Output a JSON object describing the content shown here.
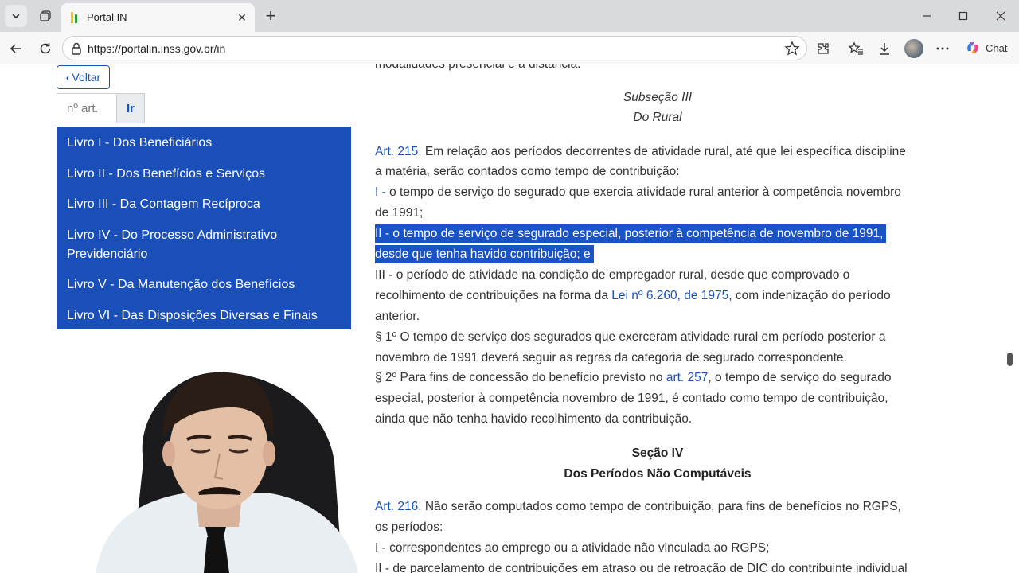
{
  "browser": {
    "tab_title": "Portal IN",
    "url": "https://portalin.inss.gov.br/in",
    "copilot_label": "Chat",
    "icons": [
      "tab-actions-icon",
      "workspaces-icon",
      "new-tab-icon",
      "minimize-icon",
      "maximize-icon",
      "close-window-icon",
      "back-icon",
      "refresh-icon",
      "lock-icon",
      "favorite-star-icon",
      "extensions-icon",
      "favorites-icon",
      "downloads-icon",
      "profile-avatar",
      "more-icon",
      "copilot-icon"
    ]
  },
  "sidebar": {
    "back_label": "Voltar",
    "article_placeholder": "nº art.",
    "go_label": "Ir",
    "livros": [
      {
        "line1": "Livro I - Dos Beneficiários"
      },
      {
        "line1": "Livro II - Dos Benefícios e Serviços"
      },
      {
        "line1": "Livro III - Da Contagem Recíproca"
      },
      {
        "line1": "Livro IV - Do Processo Administrativo",
        "line2": "Previdenciário"
      },
      {
        "line1": "Livro V - Da Manutenção dos Benefícios"
      },
      {
        "line1": "Livro VI - Das Disposições Diversas e Finais"
      }
    ]
  },
  "content": {
    "top_fragment": "modalidades presencial e a distância.",
    "subsecao_title": "Subseção III",
    "subsecao_subtitle": "Do Rural",
    "art215": {
      "num": "Art. 215.",
      "text1": " Em relação aos períodos decorrentes de atividade rural, até que lei específica discipline",
      "text2": "a matéria, serão contados como tempo de contribuição:",
      "inc1_mark": "I -",
      "inc1_l1": " o tempo de serviço do segurado que exercia atividade rural anterior à competência novembro",
      "inc1_l2": "de 1991;",
      "inc2_l1": "II - o tempo de serviço de segurado especial, posterior à competência de novembro de 1991,",
      "inc2_l2": "desde que tenha havido contribuição; e",
      "inc3_l1": "III - o período de atividade na condição de empregador rural, desde que comprovado o",
      "inc3_l2a": "recolhimento de contribuições na forma da ",
      "inc3_link": "Lei nº 6.260, de 1975",
      "inc3_l2b": ", com indenização do período",
      "inc3_l3": "anterior.",
      "p1_l1": "§ 1º O tempo de serviço dos segurados que exerceram atividade rural em período posterior a",
      "p1_l2": "novembro de 1991 deverá seguir as regras da categoria de segurado correspondente.",
      "p2_l1a": "§ 2º Para fins de concessão do benefício previsto no ",
      "p2_link": "art. 257",
      "p2_l1b": ", o tempo de serviço do segurado",
      "p2_l2": "especial, posterior à competência novembro de 1991, é contado como tempo de contribuição,",
      "p2_l3": "ainda que não tenha havido recolhimento da contribuição."
    },
    "secao_title": "Seção IV",
    "secao_subtitle": "Dos Períodos Não Computáveis",
    "art216": {
      "num": "Art. 216.",
      "text1": " Não serão computados como tempo de contribuição, para fins de benefícios no RGPS,",
      "text2": "os períodos:",
      "inc1": "I - correspondentes ao emprego ou a atividade não vinculada ao RGPS;",
      "inc2": "II - de parcelamento de contribuições em atraso ou de retroação de DIC do contribuinte individual"
    }
  },
  "colors": {
    "sidebar_bg": "#1a4fba",
    "link": "#1a51b8",
    "selection": "#1a53c6"
  }
}
